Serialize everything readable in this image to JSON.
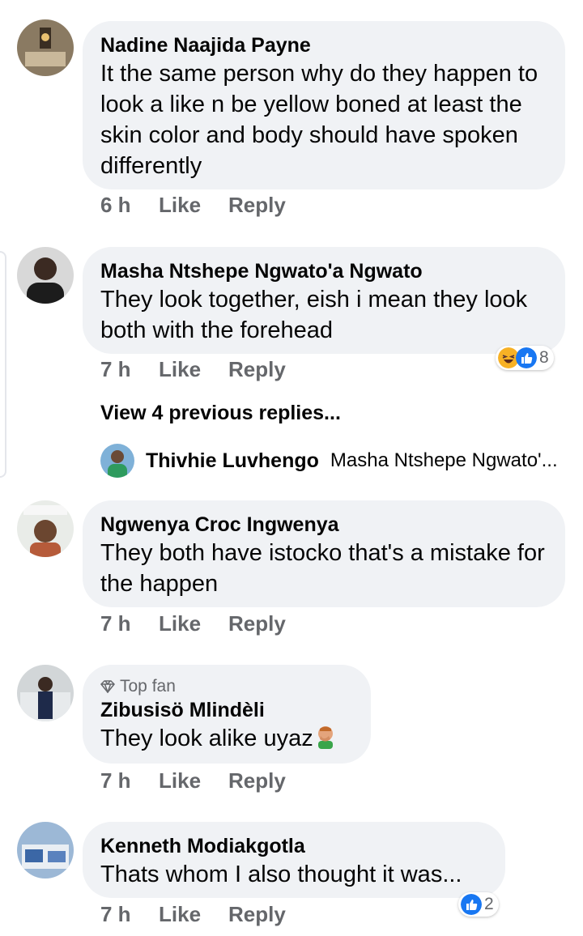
{
  "comments": [
    {
      "name": "Nadine Naajida Payne",
      "text": "It the same person why do they happen to look a like n be yellow boned at least the skin color and body should have spoken differently",
      "time": "6 h",
      "like": "Like",
      "reply": "Reply"
    },
    {
      "name": "Masha Ntshepe Ngwato'a Ngwato",
      "text": "They look together, eish i mean they look both with the forehead",
      "time": "7 h",
      "like": "Like",
      "reply": "Reply",
      "reaction_count": "8"
    },
    {
      "name": "Ngwenya Croc Ingwenya",
      "text": "They both have istocko that's a mistake for the happen",
      "time": "7 h",
      "like": "Like",
      "reply": "Reply"
    },
    {
      "badge": "Top fan",
      "name": "Zibusisö Mlindèli",
      "text": "They look alike uyaz",
      "time": "7 h",
      "like": "Like",
      "reply": "Reply"
    },
    {
      "name": "Kenneth Modiakgotla",
      "text": "Thats whom I also thought it was...",
      "time": "7 h",
      "like": "Like",
      "reply": "Reply",
      "reaction_count": "2"
    }
  ],
  "view_previous": "View 4 previous replies...",
  "reply_preview": {
    "name": "Thivhie Luvhengo",
    "text": "Masha Ntshepe Ngwato'..."
  },
  "icons": [
    "haha-reaction-icon",
    "like-reaction-icon",
    "diamond-icon",
    "facepalm-emoji-icon"
  ],
  "colors": {
    "bubble": "#f0f2f5",
    "secondary_text": "#65676b",
    "like_blue": "#1877f2",
    "haha_yellow": "#f7b125"
  }
}
